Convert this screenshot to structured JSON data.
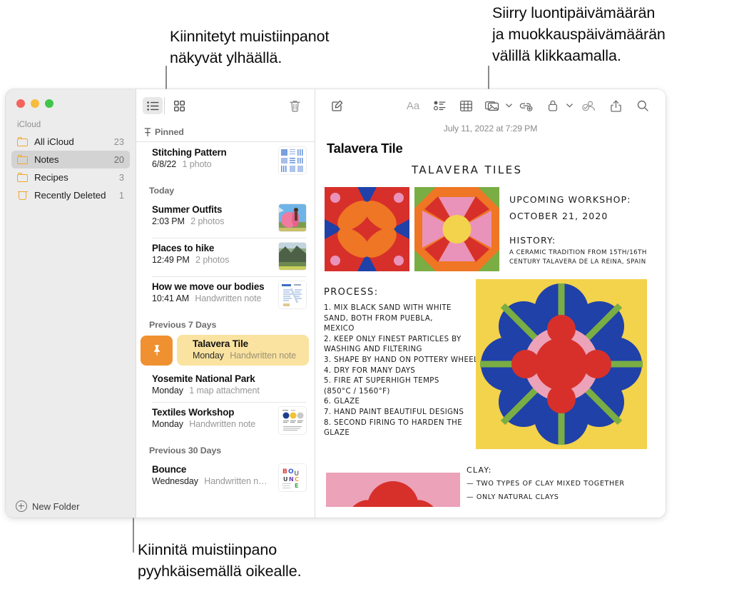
{
  "annotations": {
    "top_left": "Kiinnitetyt muistiinpanot\nnäkyvät ylhäällä.",
    "top_right": "Siirry luontipäivämäärän\nja muokkauspäivämäärän\nvälillä klikkaamalla.",
    "bottom_left": "Kiinnitä muistiinpano\npyyhkäisemällä oikealle."
  },
  "sidebar": {
    "section_label": "iCloud",
    "items": [
      {
        "label": "All iCloud",
        "count": "23",
        "icon": "folder-icon",
        "selected": false
      },
      {
        "label": "Notes",
        "count": "20",
        "icon": "folder-icon",
        "selected": true
      },
      {
        "label": "Recipes",
        "count": "3",
        "icon": "folder-icon",
        "selected": false
      },
      {
        "label": "Recently Deleted",
        "count": "1",
        "icon": "trash-icon",
        "selected": false
      }
    ],
    "new_folder_label": "New Folder"
  },
  "list_toolbar": {
    "list_view_icon": "list-view-icon",
    "gallery_view_icon": "gallery-view-icon",
    "delete_icon": "trash-icon"
  },
  "note_list": {
    "groups": [
      {
        "label": "Pinned",
        "icon": "pin-icon",
        "notes": [
          {
            "title": "Stitching Pattern",
            "date": "6/8/22",
            "meta": "1 photo",
            "thumb": "stitching-pattern-thumbnail"
          }
        ]
      },
      {
        "label": "Today",
        "notes": [
          {
            "title": "Summer Outfits",
            "date": "2:03 PM",
            "meta": "2 photos",
            "thumb": "summer-outfits-thumbnail"
          },
          {
            "title": "Places to hike",
            "date": "12:49 PM",
            "meta": "2 photos",
            "thumb": "places-to-hike-thumbnail"
          },
          {
            "title": "How we move our bodies",
            "date": "10:41 AM",
            "meta": "Handwritten note",
            "thumb": "how-we-move-thumbnail"
          }
        ]
      },
      {
        "label": "Previous 7 Days",
        "notes": [
          {
            "title": "Talavera Tile",
            "date": "Monday",
            "meta": "Handwritten note",
            "selected": true,
            "pinned_swipe": true
          },
          {
            "title": "Yosemite National Park",
            "date": "Monday",
            "meta": "1 map attachment",
            "thumb": null
          },
          {
            "title": "Textiles Workshop",
            "date": "Monday",
            "meta": "Handwritten note",
            "thumb": "textiles-workshop-thumbnail"
          }
        ]
      },
      {
        "label": "Previous 30 Days",
        "notes": [
          {
            "title": "Bounce",
            "date": "Wednesday",
            "meta": "Handwritten n…",
            "thumb": "bounce-thumbnail"
          }
        ]
      }
    ]
  },
  "detail_toolbar": {
    "compose_icon": "compose-icon",
    "format_label": "Aa",
    "checklist_icon": "checklist-icon",
    "table_icon": "table-icon",
    "media_icon": "media-icon",
    "link_icon": "add-link-icon",
    "lock_icon": "lock-icon",
    "collaborate_icon": "collaborate-icon",
    "share_icon": "share-icon",
    "search_icon": "search-icon"
  },
  "note": {
    "timestamp": "July 11, 2022 at 7:29 PM",
    "title": "Talavera Tile",
    "handwritten": {
      "heading": "TALAVERA TILES",
      "workshop_label": "UPCOMING WORKSHOP:",
      "workshop_date": "OCTOBER 21, 2020",
      "history_label": "HISTORY:",
      "history_line1": "A CERAMIC TRADITION FROM 15TH/16TH",
      "history_line2": "CENTURY TALAVERA DE LA REINA, SPAIN",
      "process_label": "PROCESS:",
      "process_steps": [
        "1. MIX BLACK SAND WITH WHITE",
        "   SAND, BOTH FROM PUEBLA,",
        "   MEXICO",
        "2. KEEP ONLY FINEST PARTICLES BY",
        "   WASHING AND FILTERING",
        "3. SHAPE BY HAND ON POTTERY WHEEL",
        "4. DRY FOR MANY DAYS",
        "5. FIRE AT SUPERHIGH TEMPS",
        "   (850°C / 1560°F)",
        "6. GLAZE",
        "7. HAND PAINT BEAUTIFUL DESIGNS",
        "8. SECOND FIRING TO HARDEN THE",
        "   GLAZE"
      ],
      "clay_label": "CLAY:",
      "clay_line1": "— TWO TYPES OF CLAY MIXED TOGETHER",
      "clay_line2": "— ONLY NATURAL CLAYS"
    }
  },
  "colors": {
    "pin_button": "#ef9130",
    "selected_row": "#fae3a0",
    "folder_icon": "#f0a830",
    "tile_red": "#d73222",
    "tile_orange": "#ef7624",
    "tile_blue": "#1f41a8",
    "tile_pink": "#e896b8",
    "tile_green": "#7aad44",
    "tile_yellow": "#f3d24c",
    "tile_lightpink": "#eca2b9"
  }
}
